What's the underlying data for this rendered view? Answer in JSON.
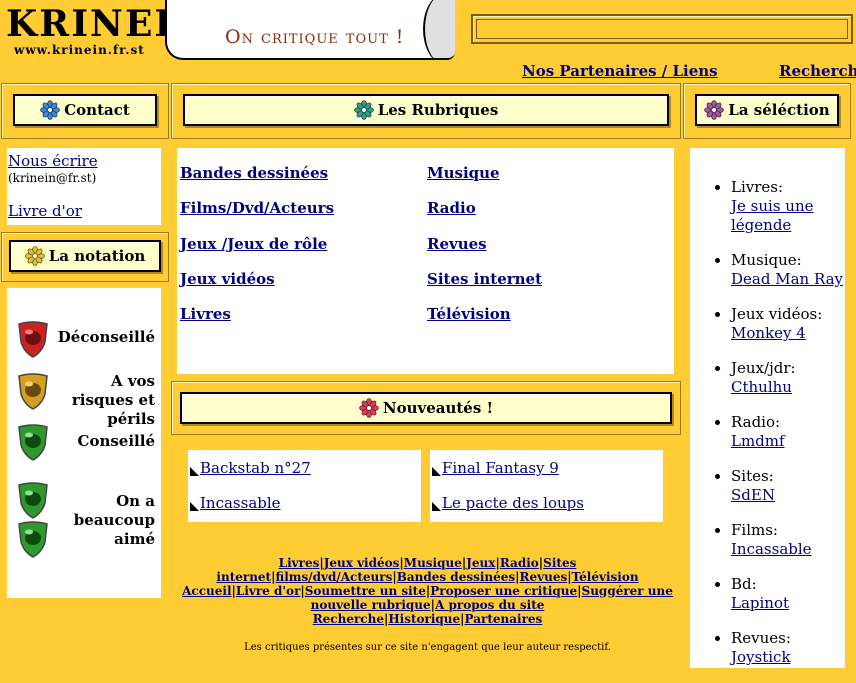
{
  "logo": {
    "title": "KRINEIN",
    "url": "www.krinein.fr.st"
  },
  "slogan": "On critique tout !",
  "top_links": {
    "partners": "Nos Partenaires / Liens",
    "search": "Recherche"
  },
  "contact": {
    "header": "Contact",
    "write": "Nous écrire",
    "email": "(krinein@fr.st)",
    "guestbook": "Livre d'or"
  },
  "rubriques": {
    "header": "Les Rubriques",
    "left": [
      "Bandes dessinées",
      "Films/Dvd/Acteurs",
      "Jeux /Jeux de rôle",
      "Jeux vidéos",
      "Livres"
    ],
    "right": [
      "Musique",
      "Radio",
      "Revues",
      "Sites internet",
      "Télévision"
    ]
  },
  "selection": {
    "header": "La séléction",
    "items": [
      {
        "category": "Livres:",
        "title": "Je suis une légende"
      },
      {
        "category": "Musique:",
        "title": "Dead Man Ray"
      },
      {
        "category": "Jeux vidéos:",
        "title": "Monkey 4"
      },
      {
        "category": "Jeux/jdr:",
        "title": "Cthulhu"
      },
      {
        "category": "Radio:",
        "title": "Lmdmf"
      },
      {
        "category": "Sites:",
        "title": "SdEN"
      },
      {
        "category": "Films:",
        "title": "Incassable"
      },
      {
        "category": "Bd:",
        "title": "Lapinot"
      },
      {
        "category": "Revues:",
        "title": "Joystick"
      }
    ]
  },
  "notation": {
    "header": "La notation",
    "levels": [
      {
        "label": "Déconseillé",
        "color": "#cc2222"
      },
      {
        "label": "A vos risques et périls",
        "color": "#d4a020"
      },
      {
        "label": "Conseillé",
        "color": "#2e9a2e"
      },
      {
        "label": "On a beaucoup aimé",
        "color": "#2e9a2e"
      }
    ]
  },
  "nouveautes": {
    "header": "Nouveautés !",
    "left": [
      "Backstab n°27",
      "Incassable"
    ],
    "right": [
      "Final Fantasy 9",
      "Le pacte des loups"
    ]
  },
  "footer": {
    "row1": [
      "Livres",
      "Jeux vidéos",
      "Musique",
      "Jeux",
      "Radio",
      "Sites internet",
      "films/dvd/Acteurs",
      "Bandes dessinées",
      "Revues",
      "Télévision"
    ],
    "row2": [
      "Accueil",
      "Livre d'or",
      "Soumettre un site",
      "Proposer une critique",
      "Suggérer une nouvelle rubrique",
      "A propos du site",
      "Recherche",
      "Historique",
      "Partenaires"
    ],
    "disclaimer": "Les critiques présentes sur ce site n'engagent que leur auteur respectif."
  },
  "colors": {
    "background": "#ffcc33",
    "header_fill": "#ffffcc",
    "link": "#000080",
    "slogan": "#8b2a0a"
  }
}
